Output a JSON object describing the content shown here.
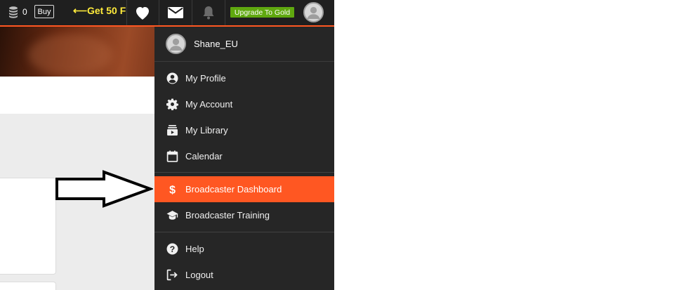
{
  "topbar": {
    "coin_count": "0",
    "buy_label": "Buy",
    "promo_text": "Get 50 F",
    "promo_arrow": "⟵",
    "upgrade_label": "Upgrade To Gold",
    "icons": [
      "coins-icon",
      "heart-icon",
      "mail-icon",
      "bell-icon",
      "avatar"
    ]
  },
  "menu": {
    "username": "Shane_EU",
    "items": [
      {
        "label": "My Profile",
        "icon": "account-circle-icon"
      },
      {
        "label": "My Account",
        "icon": "gear-icon"
      },
      {
        "label": "My Library",
        "icon": "library-icon"
      },
      {
        "label": "Calendar",
        "icon": "calendar-icon"
      },
      {
        "label": "Broadcaster Dashboard",
        "icon": "dollar-icon",
        "active": true
      },
      {
        "label": "Broadcaster Training",
        "icon": "graduation-cap-icon"
      },
      {
        "label": "Help",
        "icon": "help-icon"
      },
      {
        "label": "Logout",
        "icon": "logout-icon"
      }
    ]
  },
  "colors": {
    "accent": "#ff5722",
    "menu_bg": "#262626",
    "topbar_bg": "#1f1f1f",
    "upgrade_bg": "#5fa80f",
    "promo_text": "#ffeb3b"
  }
}
